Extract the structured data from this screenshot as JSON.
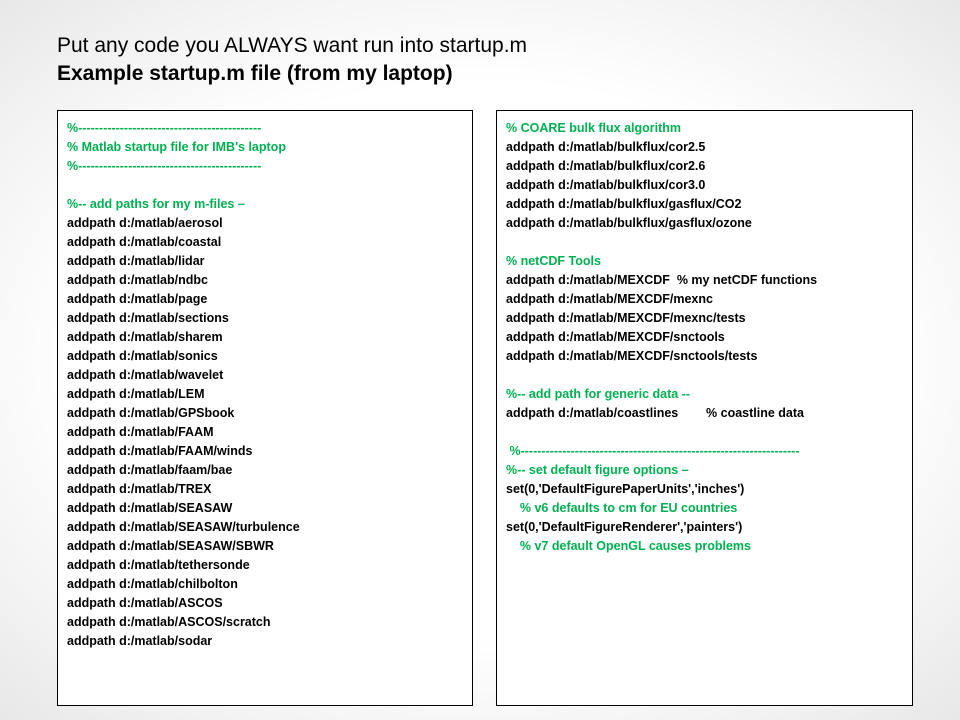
{
  "header": {
    "line1": "Put any code you ALWAYS want run into startup.m",
    "line2": "Example startup.m file (from my laptop)"
  },
  "colors": {
    "comment": "#00b050",
    "code": "#000000"
  },
  "left_panel": {
    "lines": [
      {
        "text": "%--------------------------------------------",
        "type": "comment"
      },
      {
        "text": "% Matlab startup file for IMB's laptop",
        "type": "comment"
      },
      {
        "text": "%--------------------------------------------",
        "type": "comment"
      },
      {
        "text": "",
        "type": "blank"
      },
      {
        "text": "%-- add paths for my m-files –",
        "type": "comment"
      },
      {
        "text": "addpath d:/matlab/aerosol",
        "type": "code"
      },
      {
        "text": "addpath d:/matlab/coastal",
        "type": "code"
      },
      {
        "text": "addpath d:/matlab/lidar",
        "type": "code"
      },
      {
        "text": "addpath d:/matlab/ndbc",
        "type": "code"
      },
      {
        "text": "addpath d:/matlab/page",
        "type": "code"
      },
      {
        "text": "addpath d:/matlab/sections",
        "type": "code"
      },
      {
        "text": "addpath d:/matlab/sharem",
        "type": "code"
      },
      {
        "text": "addpath d:/matlab/sonics",
        "type": "code"
      },
      {
        "text": "addpath d:/matlab/wavelet",
        "type": "code"
      },
      {
        "text": "addpath d:/matlab/LEM",
        "type": "code"
      },
      {
        "text": "addpath d:/matlab/GPSbook",
        "type": "code"
      },
      {
        "text": "addpath d:/matlab/FAAM",
        "type": "code"
      },
      {
        "text": "addpath d:/matlab/FAAM/winds",
        "type": "code"
      },
      {
        "text": "addpath d:/matlab/faam/bae",
        "type": "code"
      },
      {
        "text": "addpath d:/matlab/TREX",
        "type": "code"
      },
      {
        "text": "addpath d:/matlab/SEASAW",
        "type": "code"
      },
      {
        "text": "addpath d:/matlab/SEASAW/turbulence",
        "type": "code"
      },
      {
        "text": "addpath d:/matlab/SEASAW/SBWR",
        "type": "code"
      },
      {
        "text": "addpath d:/matlab/tethersonde",
        "type": "code"
      },
      {
        "text": "addpath d:/matlab/chilbolton",
        "type": "code"
      },
      {
        "text": "addpath d:/matlab/ASCOS",
        "type": "code"
      },
      {
        "text": "addpath d:/matlab/ASCOS/scratch",
        "type": "code"
      },
      {
        "text": "addpath d:/matlab/sodar",
        "type": "code"
      }
    ]
  },
  "right_panel": {
    "lines": [
      {
        "text": "% COARE bulk flux algorithm",
        "type": "comment"
      },
      {
        "text": "addpath d:/matlab/bulkflux/cor2.5",
        "type": "code"
      },
      {
        "text": "addpath d:/matlab/bulkflux/cor2.6",
        "type": "code"
      },
      {
        "text": "addpath d:/matlab/bulkflux/cor3.0",
        "type": "code"
      },
      {
        "text": "addpath d:/matlab/bulkflux/gasflux/CO2",
        "type": "code"
      },
      {
        "text": "addpath d:/matlab/bulkflux/gasflux/ozone",
        "type": "code"
      },
      {
        "text": "",
        "type": "blank"
      },
      {
        "text": "% netCDF Tools",
        "type": "comment"
      },
      {
        "text": "addpath d:/matlab/MEXCDF  % my netCDF functions",
        "type": "code"
      },
      {
        "text": "addpath d:/matlab/MEXCDF/mexnc",
        "type": "code"
      },
      {
        "text": "addpath d:/matlab/MEXCDF/mexnc/tests",
        "type": "code"
      },
      {
        "text": "addpath d:/matlab/MEXCDF/snctools",
        "type": "code"
      },
      {
        "text": "addpath d:/matlab/MEXCDF/snctools/tests",
        "type": "code"
      },
      {
        "text": "",
        "type": "blank"
      },
      {
        "text": "%-- add path for generic data --",
        "type": "comment"
      },
      {
        "text": "addpath d:/matlab/coastlines        % coastline data",
        "type": "code"
      },
      {
        "text": "",
        "type": "blank"
      },
      {
        "text": " %-------------------------------------------------------------------",
        "type": "comment"
      },
      {
        "text": "%-- set default figure options –",
        "type": "comment"
      },
      {
        "text": "set(0,'DefaultFigurePaperUnits','inches')",
        "type": "code"
      },
      {
        "text": "    % v6 defaults to cm for EU countries",
        "type": "comment"
      },
      {
        "text": "set(0,'DefaultFigureRenderer','painters')",
        "type": "code"
      },
      {
        "text": "    % v7 default OpenGL causes problems",
        "type": "comment"
      }
    ]
  }
}
